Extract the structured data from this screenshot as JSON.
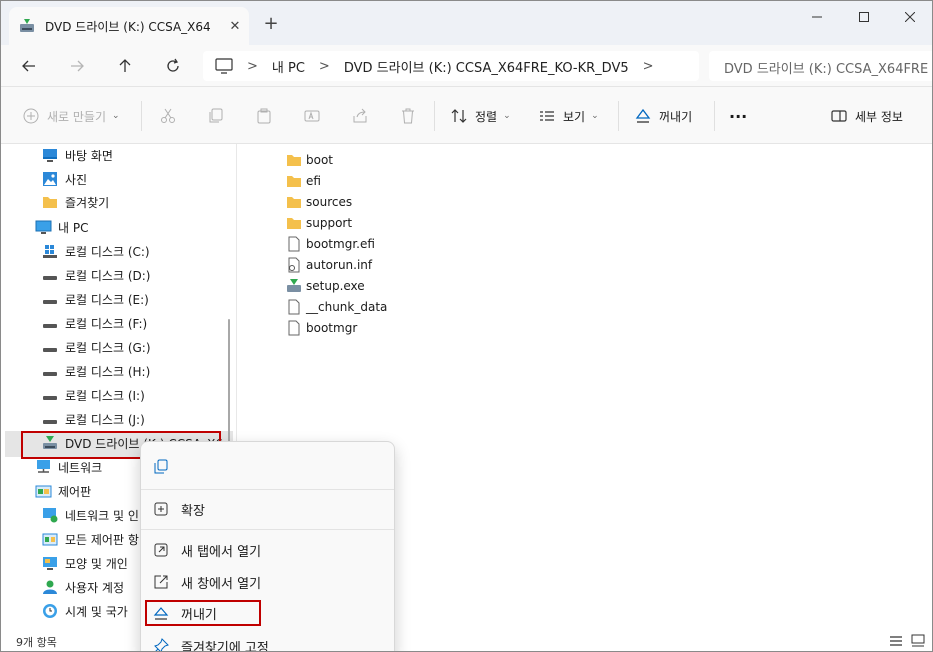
{
  "tab": {
    "title": "DVD 드라이브 (K:) CCSA_X64",
    "close": "✕",
    "new": "+"
  },
  "window": {
    "minimize": "—",
    "maximize": "☐",
    "close": "✕"
  },
  "addressbar": {
    "breadcrumb": [
      "내 PC",
      "DVD 드라이브 (K:) CCSA_X64FRE_KO-KR_DV5"
    ],
    "separator": ">",
    "search_text": "DVD 드라이브 (K:) CCSA_X64FRE"
  },
  "commandbar": {
    "new": "새로 만들기",
    "sort": "정렬",
    "view": "보기",
    "eject": "꺼내기",
    "more": "···",
    "details": "세부 정보"
  },
  "sidebar": {
    "items": [
      {
        "label": "바탕 화면",
        "icon": "desktop-icon"
      },
      {
        "label": "사진",
        "icon": "pictures-icon"
      },
      {
        "label": "즐겨찾기",
        "icon": "folder-icon"
      },
      {
        "label": "내 PC",
        "icon": "this-pc-icon"
      },
      {
        "label": "로컬 디스크 (C:)",
        "icon": "windows-drive-icon"
      },
      {
        "label": "로컬 디스크 (D:)",
        "icon": "drive-icon"
      },
      {
        "label": "로컬 디스크 (E:)",
        "icon": "drive-icon"
      },
      {
        "label": "로컬 디스크 (F:)",
        "icon": "drive-icon"
      },
      {
        "label": "로컬 디스크 (G:)",
        "icon": "drive-icon"
      },
      {
        "label": "로컬 디스크 (H:)",
        "icon": "drive-icon"
      },
      {
        "label": "로컬 디스크 (I:)",
        "icon": "drive-icon"
      },
      {
        "label": "로컬 디스크 (J:)",
        "icon": "drive-icon"
      },
      {
        "label": "DVD 드라이브 (K:) CCSA_X6",
        "icon": "dvd-drive-icon"
      },
      {
        "label": "네트워크",
        "icon": "network-icon"
      },
      {
        "label": "제어판",
        "icon": "control-panel-icon"
      },
      {
        "label": "네트워크 및 인",
        "icon": "network-settings-icon"
      },
      {
        "label": "모든 제어판 항",
        "icon": "control-panel-icon"
      },
      {
        "label": "모양 및 개인",
        "icon": "appearance-icon"
      },
      {
        "label": "사용자 계정",
        "icon": "user-icon"
      },
      {
        "label": "시계 및 국가",
        "icon": "clock-icon"
      }
    ]
  },
  "files": [
    {
      "name": "boot",
      "icon": "folder-icon"
    },
    {
      "name": "efi",
      "icon": "folder-icon"
    },
    {
      "name": "sources",
      "icon": "folder-icon"
    },
    {
      "name": "support",
      "icon": "folder-icon"
    },
    {
      "name": "bootmgr.efi",
      "icon": "file-icon"
    },
    {
      "name": "autorun.inf",
      "icon": "settings-file-icon"
    },
    {
      "name": "setup.exe",
      "icon": "setup-icon"
    },
    {
      "name": "__chunk_data",
      "icon": "file-icon"
    },
    {
      "name": "bootmgr",
      "icon": "file-icon"
    }
  ],
  "status": {
    "count": "9개 항목"
  },
  "context_menu": {
    "expand": "확장",
    "open_new_tab": "새 탭에서 열기",
    "open_new_window": "새 창에서 열기",
    "eject": "꺼내기",
    "pin_quick_access": "즐겨찾기에 고정"
  },
  "colors": {
    "highlight_box": "#c00000",
    "folder": "#f4c04c",
    "accent": "#0067c0"
  }
}
